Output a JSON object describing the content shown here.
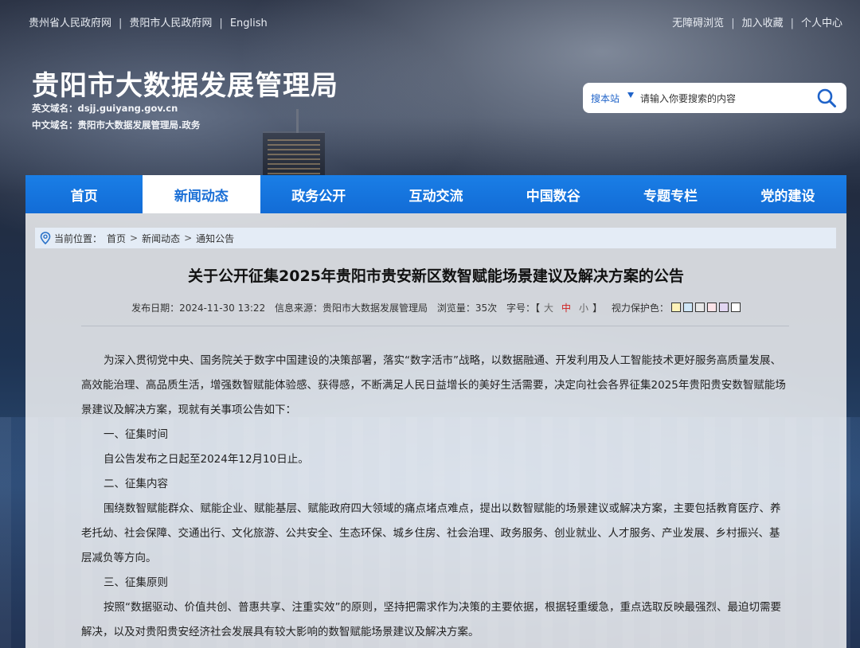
{
  "topbar": {
    "left_links": [
      "贵州省人民政府网",
      "贵阳市人民政府网",
      "English"
    ],
    "right_links": [
      "无障碍浏览",
      "加入收藏",
      "个人中心"
    ]
  },
  "brand": {
    "title": "贵阳市大数据发展管理局",
    "en_domain": "英文域名：dsjj.guiyang.gov.cn",
    "cn_domain": "中文域名：贵阳市大数据发展管理局.政务"
  },
  "search": {
    "scope": "搜本站",
    "placeholder": "请输入你要搜索的内容",
    "icon": "search-icon"
  },
  "nav": {
    "items": [
      "首页",
      "新闻动态",
      "政务公开",
      "互动交流",
      "中国数谷",
      "专题专栏",
      "党的建设"
    ],
    "active": "新闻动态"
  },
  "breadcrumb": {
    "label": "当前位置：",
    "items": [
      "首页",
      "新闻动态",
      "通知公告"
    ]
  },
  "article": {
    "title": "关于公开征集2025年贵阳市贵安新区数智赋能场景建议及解决方案的公告",
    "meta": {
      "date": "发布日期：2024-11-30 13:22",
      "source": "信息来源：贵阳市大数据发展管理局",
      "views": "浏览量：35次",
      "font_label": "字号：",
      "bracket_open": "【",
      "font_large": "大",
      "font_medium": "中",
      "font_small": "小",
      "bracket_close": "】",
      "protect_label": "视力保护色：",
      "swatches": [
        "#fdf2b8",
        "#cfe6f7",
        "#e8e8e8",
        "#fbe3e8",
        "#e2d6f2",
        "#ffffff"
      ]
    },
    "paragraphs": [
      "为深入贯彻党中央、国务院关于数字中国建设的决策部署，落实“数字活市”战略，以数据融通、开发利用及人工智能技术更好服务高质量发展、高效能治理、高品质生活，增强数智赋能体验感、获得感，不断满足人民日益增长的美好生活需要，决定向社会各界征集2025年贵阳贵安数智赋能场景建议及解决方案，现就有关事项公告如下：",
      "一、征集时间",
      "自公告发布之日起至2024年12月10日止。",
      "二、征集内容",
      "围绕数智赋能群众、赋能企业、赋能基层、赋能政府四大领域的痛点堵点难点，提出以数智赋能的场景建议或解决方案，主要包括教育医疗、养老托幼、社会保障、交通出行、文化旅游、公共安全、生态环保、城乡住房、社会治理、政务服务、创业就业、人才服务、产业发展、乡村振兴、基层减负等方向。",
      "三、征集原则",
      "按照“数据驱动、价值共创、普惠共享、注重实效”的原则，坚持把需求作为决策的主要依据，根据轻重缓急，重点选取反映最强烈、最迫切需要解决，以及对贵阳贵安经济社会发展具有较大影响的数智赋能场景建议及解决方案。"
    ]
  }
}
